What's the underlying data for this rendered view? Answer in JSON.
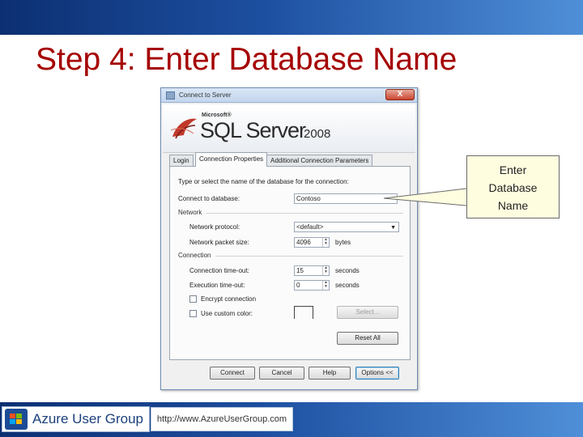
{
  "slide": {
    "title": "Step 4: Enter Database Name",
    "footer_brand": "Azure User Group",
    "footer_url": "http://www.AzureUserGroup.com"
  },
  "dialog": {
    "title": "Connect to Server",
    "close_label": "X",
    "banner": {
      "microsoft": "Microsoft®",
      "product": "SQL Server",
      "version": "2008"
    },
    "tabs": [
      "Login",
      "Connection Properties",
      "Additional Connection Parameters"
    ],
    "active_tab": 1,
    "instruction": "Type or select the name of the database for the connection:",
    "connect_db_label": "Connect to database:",
    "connect_db_value": "Contoso",
    "network_group": "Network",
    "network_protocol_label": "Network protocol:",
    "network_protocol_value": "<default>",
    "packet_size_label": "Network packet size:",
    "packet_size_value": "4096",
    "packet_size_unit": "bytes",
    "connection_group": "Connection",
    "conn_timeout_label": "Connection time-out:",
    "conn_timeout_value": "15",
    "conn_timeout_unit": "seconds",
    "exec_timeout_label": "Execution time-out:",
    "exec_timeout_value": "0",
    "exec_timeout_unit": "seconds",
    "encrypt_label": "Encrypt connection",
    "custom_color_label": "Use custom color:",
    "select_button": "Select...",
    "reset_button": "Reset All",
    "footer_buttons": [
      "Connect",
      "Cancel",
      "Help",
      "Options <<"
    ]
  },
  "callout": {
    "lines": [
      "Enter",
      "Database",
      "Name"
    ]
  },
  "colors": {
    "title_red": "#a50000",
    "band_blue": "#1d4fa0",
    "callout_fill": "#fffde0"
  }
}
